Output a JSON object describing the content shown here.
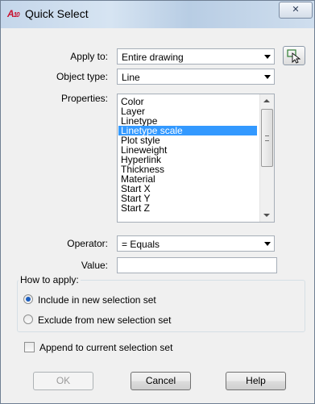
{
  "window": {
    "app_icon_text": "A",
    "app_icon_sub": "10",
    "title": "Quick Select",
    "close_glyph": "✕"
  },
  "fields": {
    "apply_to": {
      "label": "Apply to:",
      "value": "Entire drawing"
    },
    "object_type": {
      "label": "Object type:",
      "value": "Line"
    },
    "properties": {
      "label": "Properties:",
      "items": [
        "Color",
        "Layer",
        "Linetype",
        "Linetype scale",
        "Plot style",
        "Lineweight",
        "Hyperlink",
        "Thickness",
        "Material",
        "Start X",
        "Start Y",
        "Start Z"
      ],
      "selected": "Linetype scale"
    },
    "operator": {
      "label": "Operator:",
      "value": "= Equals"
    },
    "value": {
      "label": "Value:",
      "value": ""
    }
  },
  "how_to_apply": {
    "label": "How to apply:",
    "options": [
      {
        "label": "Include in new selection set",
        "checked": true
      },
      {
        "label": "Exclude from new selection set",
        "checked": false
      }
    ]
  },
  "append": {
    "label": "Append to current selection set",
    "checked": false
  },
  "buttons": {
    "ok": "OK",
    "cancel": "Cancel",
    "help": "Help"
  },
  "colors": {
    "selection": "#3399ff",
    "app_icon": "#c8102e"
  }
}
